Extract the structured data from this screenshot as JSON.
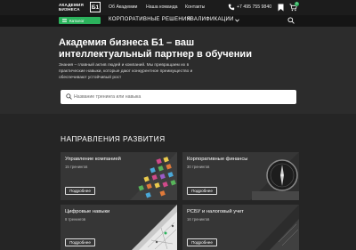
{
  "header": {
    "logo_line1": "АКАДЕМИЯ",
    "logo_line2": "БИЗНЕСА",
    "logo_mark": "Б1",
    "nav": [
      "Об Академии",
      "Наша команда",
      "Контакты"
    ],
    "phone": "+7 495 755 9840",
    "cart_count": "0",
    "icons": [
      "phone-icon",
      "bookmark-icon",
      "cart-icon"
    ]
  },
  "menu": {
    "catalog_label": "Каталог",
    "items": [
      "КОРПОРАТИВНЫЕ РЕШЕНИЯ",
      "КВАЛИФИКАЦИИ"
    ]
  },
  "hero": {
    "title": "Академия бизнеса Б1 – ваш интеллектуальный партнер в обучении",
    "subtitle": "Знания – главный актив людей и компаний. Мы превращаем их в практические навыки, которые дают конкурентное преимущество и обеспечивают устойчивый рост",
    "search_placeholder": "Название тренинга или навыка"
  },
  "section": {
    "title": "НАПРАВЛЕНИЯ РАЗВИТИЯ",
    "cards": [
      {
        "title": "Управление компанией",
        "count": "15 тренингов",
        "button": "Подробнее"
      },
      {
        "title": "Корпоративные финансы",
        "count": "30 тренингов",
        "button": "Подробнее"
      },
      {
        "title": "Цифровые навыки",
        "count": "8 тренингов",
        "button": "Подробнее"
      },
      {
        "title": "РСБУ и налоговый учет",
        "count": "16 тренингов",
        "button": "Подробнее"
      }
    ]
  },
  "colors": {
    "accent": "#2bb25c",
    "header": "#1c1c1c",
    "card": "#363636"
  }
}
